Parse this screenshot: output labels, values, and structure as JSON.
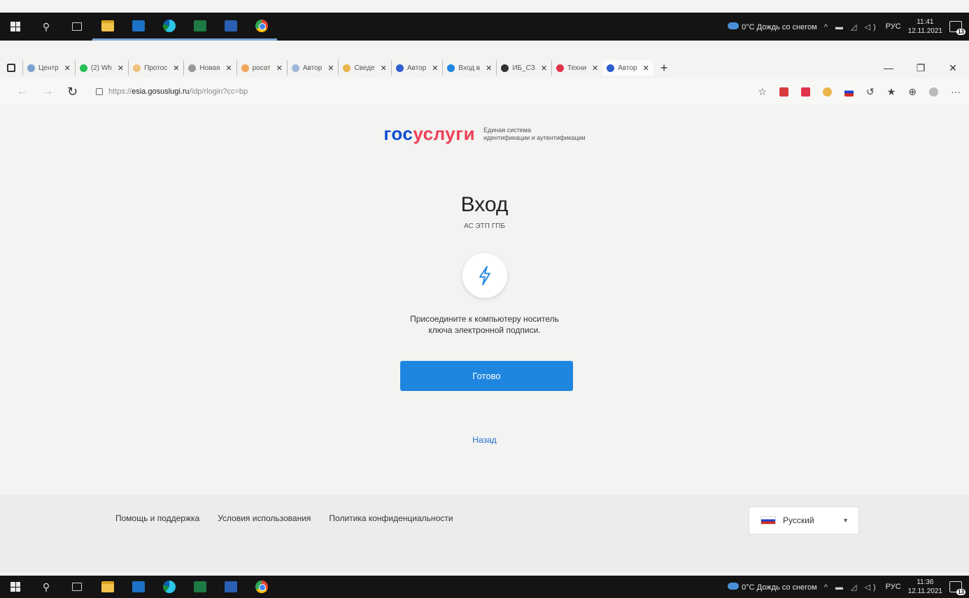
{
  "taskbar_top": {
    "weather": "0°C Дождь со снегом",
    "lang": "РУС",
    "time": "11:41",
    "date": "12.11.2021",
    "notif_count": "13"
  },
  "taskbar_bottom": {
    "weather": "0°C Дождь со снегом",
    "lang": "РУС",
    "time": "11:36",
    "date": "12.11.2021",
    "notif_count": "13"
  },
  "tabs": [
    {
      "label": "Центр",
      "favicon_color": "#7aa0d0"
    },
    {
      "label": "(2) Wh",
      "favicon_color": "#25c05a"
    },
    {
      "label": "Протос",
      "favicon_color": "#f1c27d"
    },
    {
      "label": "Новая",
      "favicon_color": "#999999"
    },
    {
      "label": "росат",
      "favicon_color": "#f2a65a"
    },
    {
      "label": "Автор",
      "favicon_color": "#9fb6d9"
    },
    {
      "label": "Сведе",
      "favicon_color": "#e9b44c"
    },
    {
      "label": "Автор",
      "favicon_color": "#2f5fd0"
    },
    {
      "label": "Вход в",
      "favicon_color": "#1f86e0"
    },
    {
      "label": "ИБ_СЗ",
      "favicon_color": "#333333"
    },
    {
      "label": "Техни",
      "favicon_color": "#e0334a"
    },
    {
      "label": "Автор",
      "favicon_color": "#2f5fd0"
    }
  ],
  "address": {
    "prefix": "https://",
    "host": "esia.gosuslugi.ru",
    "path": "/idp/rlogin?cc=bp"
  },
  "logo": {
    "part1": "гос",
    "part2": "услуги",
    "sub_line1": "Единая система",
    "sub_line2": "идентификации и аутентификации"
  },
  "login": {
    "title": "Вход",
    "subtitle": "АС ЭТП ГПБ",
    "instruction_line1": "Присоедините к компьютеру носитель",
    "instruction_line2": "ключа электронной подписи.",
    "button_label": "Готово",
    "back_label": "Назад"
  },
  "footer": {
    "links": [
      "Помощь и поддержка",
      "Условия использования",
      "Политика конфиденциальности"
    ],
    "language": "Русский"
  },
  "colors": {
    "accent_button": "#1f86e0",
    "logo_blue": "#0d4cd3",
    "logo_red": "#ee3f58"
  }
}
